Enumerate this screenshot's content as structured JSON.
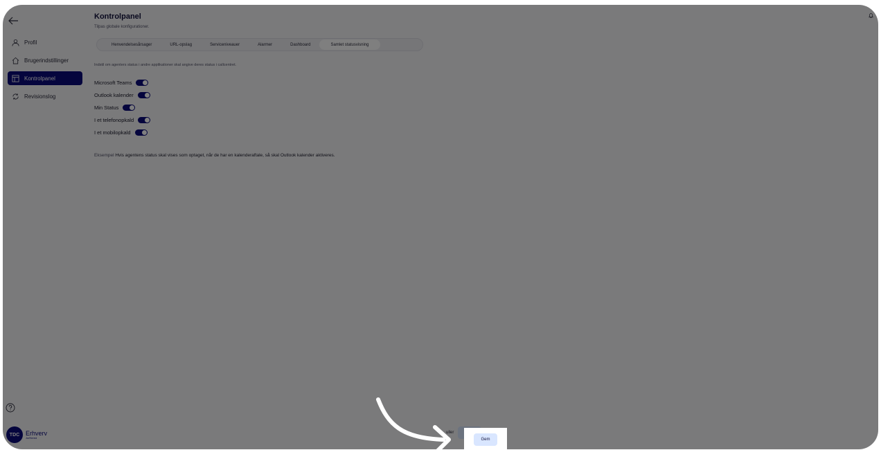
{
  "sidebar": {
    "back_icon": "arrow-left-icon",
    "items": [
      {
        "label": "Profil",
        "icon": "user-icon"
      },
      {
        "label": "Brugerindstillinger",
        "icon": "home-icon"
      },
      {
        "label": "Kontrolpanel",
        "icon": "layout-icon",
        "active": true
      },
      {
        "label": "Revisionslog",
        "icon": "refresh-icon"
      }
    ],
    "help_icon": "question-circle-icon",
    "brand": {
      "logo_text": "TDC",
      "name": "Erhverv",
      "sub": "Jo/Hered"
    }
  },
  "header": {
    "title": "Kontrolpanel",
    "subtitle": "Tilpas globale konfigurationer."
  },
  "tabs": [
    {
      "label": "Henvendelsesårsager"
    },
    {
      "label": "URL-opslag"
    },
    {
      "label": "Serviceniveauer"
    },
    {
      "label": "Alarmer"
    },
    {
      "label": "Dashboard"
    },
    {
      "label": "Samlet statusvisning",
      "active": true
    }
  ],
  "content": {
    "intro": "Indstil om agenters status i andre applikationer skal angive deres status i callcentret.",
    "settings": [
      {
        "label": "Microsoft Teams",
        "enabled": true
      },
      {
        "label": "Outlook kalender",
        "enabled": true
      },
      {
        "label": "Min Status",
        "enabled": true
      },
      {
        "label": "I et telefonopkald",
        "enabled": true
      },
      {
        "label": "I et mobilopkald",
        "enabled": true
      }
    ],
    "example_prefix": "Eksempel",
    "example_text": "Hvis agentens status skal vises som optaget, når de har en kalenderaftale, så skal Outlook kalender aktiveres."
  },
  "footer": {
    "cancel_label": "uller",
    "save_label": "Gem"
  },
  "colors": {
    "accent": "#0a0a7a",
    "save_bg": "#d9e6ff",
    "overlay": "rgba(0,0,0,0.5)"
  }
}
